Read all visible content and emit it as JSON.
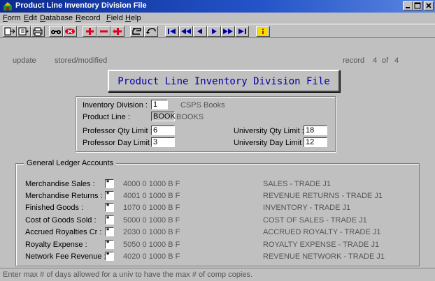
{
  "window": {
    "title": "Product Line Inventory Division File",
    "icon": "app-icon"
  },
  "menu": [
    {
      "label": "Form"
    },
    {
      "label": "Edit"
    },
    {
      "label": "Database"
    },
    {
      "label": "Record"
    },
    {
      "label": "Field"
    },
    {
      "label": "Help"
    }
  ],
  "toolbar": {
    "groups": [
      [
        "exit-icon",
        "enter-query-icon",
        "print-icon"
      ],
      [
        "binoculars-icon",
        "clear-icon"
      ],
      [
        "insert-record-icon",
        "delete-record-icon",
        "duplicate-record-icon"
      ],
      [
        "save-icon",
        "rollback-icon"
      ],
      [
        "first-record-icon",
        "previous-block-icon",
        "previous-record-icon",
        "next-record-icon",
        "next-block-icon",
        "last-record-icon"
      ],
      [
        "info-icon"
      ]
    ],
    "colors": {
      "accent_red": "#e0001a",
      "nav_blue": "#0000a8",
      "info_yellow": "#f0e000"
    }
  },
  "statusline": {
    "mode": "update",
    "state": "stored/modified",
    "record_label": "record",
    "record_index": "4",
    "record_of": "of",
    "record_total": "4"
  },
  "heading": "Product Line Inventory Division File",
  "form": {
    "inventory_division": {
      "label": "Inventory Division :",
      "value": "1",
      "desc": "CSPS Books"
    },
    "product_line": {
      "label": "Product Line :",
      "value": "BOOK",
      "desc": "BOOKS"
    },
    "professor_qty_limit": {
      "label": "Professor Qty Limit :",
      "value": "6"
    },
    "professor_day_limit": {
      "label": "Professor Day Limit :",
      "value": "3"
    },
    "university_qty_limit": {
      "label": "University Qty Limit :",
      "value": "18"
    },
    "university_day_limit": {
      "label": "University Day Limit :",
      "value": "12"
    }
  },
  "gl": {
    "title": "General Ledger Accounts",
    "rows": [
      {
        "label": "Merchandise Sales :",
        "mark": "*",
        "account": "4000  0  1000  B F",
        "desc": "SALES - TRADE J1"
      },
      {
        "label": "Merchandise Returns :",
        "mark": "*",
        "account": "4001  0  1000  B F",
        "desc": "REVENUE RETURNS - TRADE J1"
      },
      {
        "label": "Finished Goods :",
        "mark": "*",
        "account": "1070  0  1000  B F",
        "desc": "INVENTORY - TRADE J1"
      },
      {
        "label": "Cost of Goods Sold :",
        "mark": "*",
        "account": "5000  0  1000  B F",
        "desc": "COST OF SALES - TRADE J1"
      },
      {
        "label": "Accrued Royalties Cr :",
        "mark": "*",
        "account": "2030  0  1000  B F",
        "desc": "ACCRUED ROYALTY - TRADE J1"
      },
      {
        "label": "Royalty Expense :",
        "mark": "*",
        "account": "5050  0  1000  B F",
        "desc": "ROYALTY EXPENSE - TRADE J1"
      },
      {
        "label": "Network Fee Revenue :",
        "mark": "*",
        "account": "4020  0  1000  B F",
        "desc": "REVENUE NETWORK - TRADE J1"
      }
    ]
  },
  "hint": "Enter max # of days allowed for a univ to have the max # of comp copies."
}
